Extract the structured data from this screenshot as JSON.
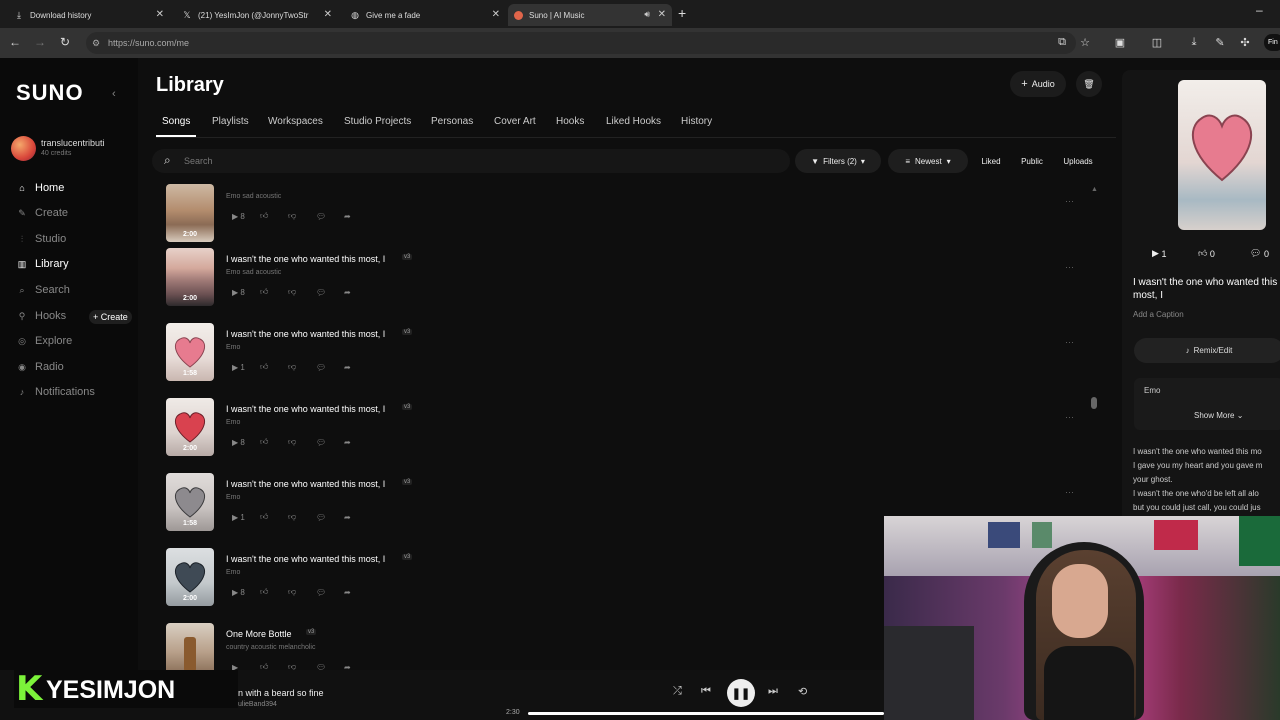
{
  "browser": {
    "tabs": [
      {
        "title": "Download history",
        "icon": "download-icon"
      },
      {
        "title": "(21) YesImJon (@JonnyTwoStr",
        "icon": "x-logo-icon"
      },
      {
        "title": "Give me a fade",
        "icon": "globe-icon"
      },
      {
        "title": "Suno | AI Music",
        "icon": "suno-icon"
      }
    ],
    "url": "https://suno.com/me"
  },
  "sidebar": {
    "logo": "SUNO",
    "user": {
      "name": "translucentributi",
      "credits": "40 credits"
    },
    "items": [
      {
        "label": "Home",
        "icon": "home-icon",
        "active": true
      },
      {
        "label": "Create",
        "icon": "create-icon",
        "active": false
      },
      {
        "label": "Studio",
        "icon": "studio-icon",
        "active": false
      },
      {
        "label": "Library",
        "icon": "library-icon",
        "active": true
      },
      {
        "label": "Search",
        "icon": "search-icon",
        "active": false
      },
      {
        "label": "Hooks",
        "icon": "hooks-icon",
        "active": false
      },
      {
        "label": "Explore",
        "icon": "explore-icon",
        "active": false
      },
      {
        "label": "Radio",
        "icon": "radio-icon",
        "active": false
      },
      {
        "label": "Notifications",
        "icon": "bell-icon",
        "active": false
      }
    ],
    "create_pill": "+ Create"
  },
  "main": {
    "title": "Library",
    "audio_button": "Audio",
    "tabs": [
      "Songs",
      "Playlists",
      "Workspaces",
      "Studio Projects",
      "Personas",
      "Cover Art",
      "Hooks",
      "Liked Hooks",
      "History"
    ],
    "search_placeholder": "Search",
    "filters": "Filters (2)",
    "sort": "Newest",
    "chips": [
      "Liked",
      "Public",
      "Uploads"
    ]
  },
  "songs": [
    {
      "title": "",
      "version": "",
      "style": "Emo sad acoustic",
      "duration": "2:00",
      "plays": "8",
      "thumb": "sunset-beach"
    },
    {
      "title": "I wasn't the one who wanted this most, I",
      "version": "v3",
      "style": "Emo sad acoustic",
      "duration": "2:00",
      "plays": "8",
      "thumb": "sunset-sea"
    },
    {
      "title": "I wasn't the one who wanted this most, I",
      "version": "v3",
      "style": "Emo",
      "duration": "1:58",
      "plays": "1",
      "thumb": "heart-pink"
    },
    {
      "title": "I wasn't the one who wanted this most, I",
      "version": "v3",
      "style": "Emo",
      "duration": "2:00",
      "plays": "8",
      "thumb": "heart-red"
    },
    {
      "title": "I wasn't the one who wanted this most, I",
      "version": "v3",
      "style": "Emo",
      "duration": "1:58",
      "plays": "1",
      "thumb": "heart-grey"
    },
    {
      "title": "I wasn't the one who wanted this most, I",
      "version": "v3",
      "style": "Emo",
      "duration": "2:00",
      "plays": "8",
      "thumb": "heart-dark"
    },
    {
      "title": "One More Bottle",
      "version": "v3",
      "style": "country acoustic melancholic",
      "duration": "",
      "plays": "",
      "thumb": "bottle"
    }
  ],
  "detail": {
    "plays": "1",
    "likes": "0",
    "comments": "0",
    "title": "I wasn't the one who wanted this most, I",
    "caption": "Add a Caption",
    "remix": "Remix/Edit",
    "style": "Emo",
    "show_more": "Show More",
    "lyrics": [
      "I wasn't the one who wanted this mo",
      "I gave you my heart and you gave m",
      "your ghost.",
      "I wasn't the one who'd be left all alo",
      "but you could just call, you could jus"
    ]
  },
  "player": {
    "now_title": "n with a beard so fine",
    "now_artist": "ulieBand394",
    "time": "2:30",
    "progress": 0.4
  },
  "watermark": {
    "k": "K",
    "text": "YESIMJON"
  },
  "colors": {
    "accent_green": "#7cf33a",
    "bg": "#0e0e0e"
  }
}
